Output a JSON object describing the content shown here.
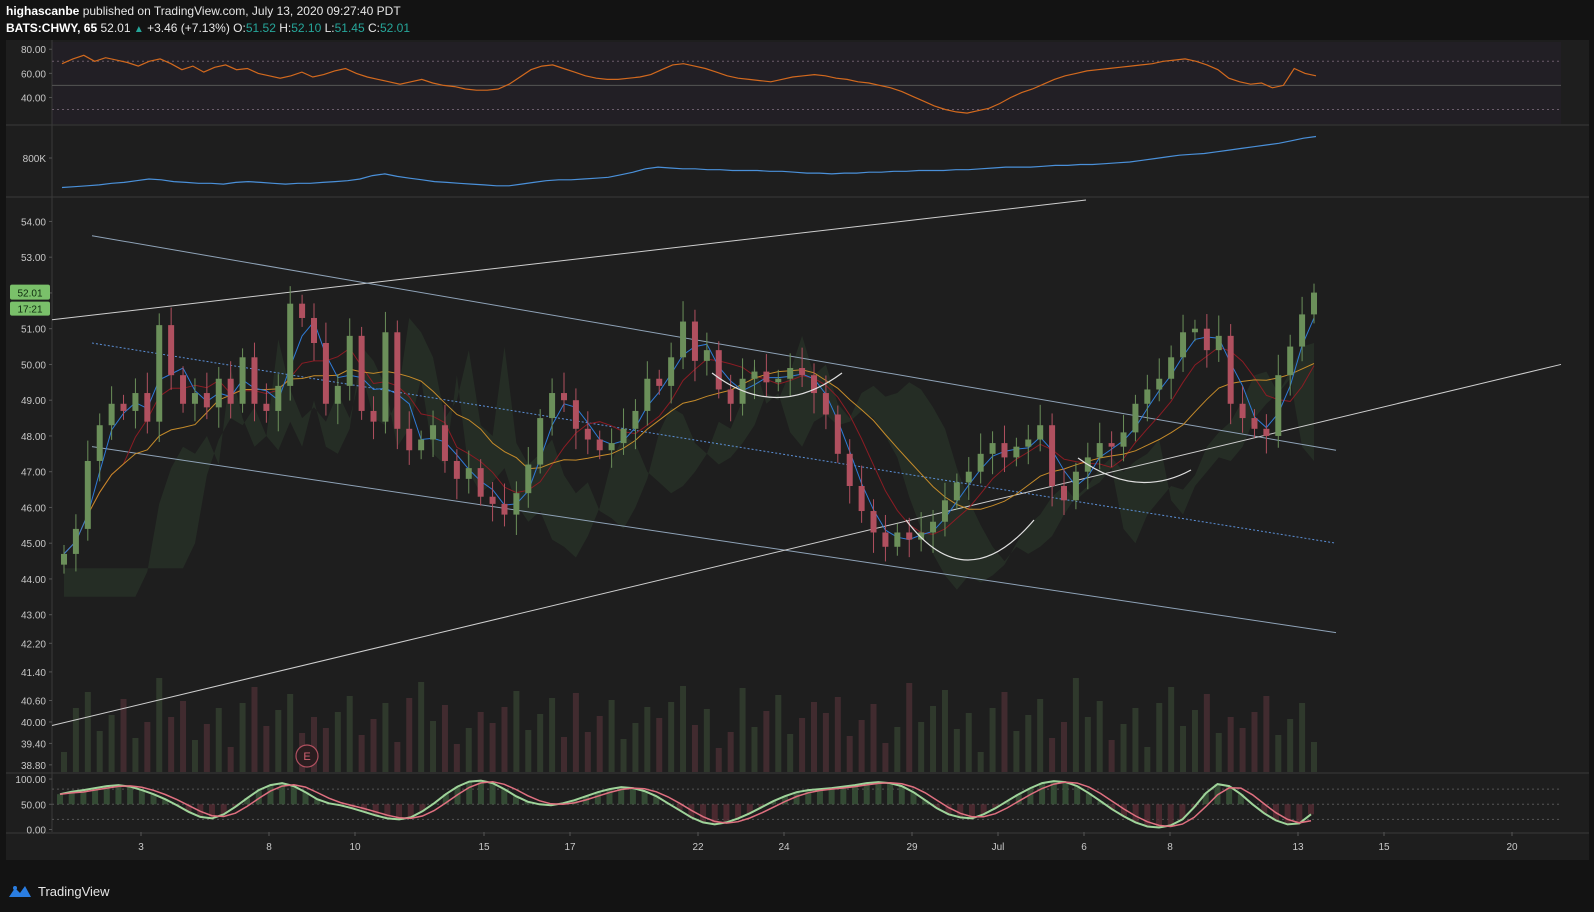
{
  "header": {
    "author": "highascanbe",
    "published_text": " published on TradingView.com, July 13, 2020 09:27:40 PDT",
    "symbol": "BATS:CHWY, 65",
    "last": "52.01",
    "change": "+3.46 (+7.13%)",
    "o_label": "O:",
    "o_value": "51.52",
    "h_label": "H:",
    "h_value": "52.10",
    "l_label": "L:",
    "l_value": "51.45",
    "c_label": "C:",
    "c_value": "52.01"
  },
  "footer": {
    "brand": "TradingView",
    "logo_icon": "tradingview-logo-icon"
  },
  "colors": {
    "background": "#1e1e1e",
    "up": "#6b8f5a",
    "down": "#b0505f",
    "rsi": "#d2691e",
    "volume_ma": "#4a90d9",
    "ema_fast": "#2f7bd6",
    "ema_slow": "#c58b2a",
    "kijun": "#8b1c24"
  },
  "chart_data": [
    {
      "type": "line",
      "panel": "rsi",
      "y_ticks": [
        "80.00",
        "60.00",
        "40.00"
      ],
      "ylim": [
        18,
        86
      ],
      "values": [
        68,
        72,
        75,
        70,
        73,
        71,
        69,
        66,
        70,
        72,
        68,
        63,
        66,
        61,
        65,
        67,
        63,
        64,
        60,
        58,
        56,
        58,
        61,
        57,
        59,
        62,
        64,
        60,
        57,
        55,
        53,
        51,
        53,
        55,
        52,
        50,
        49,
        47,
        46,
        46,
        47,
        51,
        57,
        63,
        66,
        67,
        64,
        61,
        58,
        56,
        55,
        55,
        56,
        57,
        59,
        63,
        67,
        68,
        66,
        64,
        61,
        58,
        56,
        55,
        54,
        53,
        55,
        57,
        58,
        59,
        58,
        56,
        55,
        53,
        52,
        50,
        48,
        45,
        41,
        37,
        33,
        30,
        28,
        27,
        29,
        31,
        35,
        40,
        44,
        47,
        51,
        55,
        58,
        60,
        62,
        63,
        64,
        65,
        66,
        67,
        68,
        70,
        71,
        72,
        70,
        67,
        63,
        56,
        53,
        51,
        52,
        48,
        50,
        64,
        60,
        58
      ],
      "bands": [
        70,
        50,
        30
      ]
    },
    {
      "type": "line",
      "panel": "volume_ma",
      "y_ticks": [
        "800K"
      ],
      "values": [
        40,
        41,
        42,
        43,
        45,
        46,
        48,
        50,
        49,
        47,
        46,
        45,
        45,
        44,
        46,
        47,
        46,
        45,
        44,
        45,
        45,
        46,
        47,
        48,
        50,
        54,
        56,
        53,
        51,
        49,
        47,
        46,
        45,
        44,
        43,
        42,
        42,
        44,
        46,
        48,
        49,
        49,
        50,
        51,
        52,
        55,
        58,
        62,
        64,
        63,
        62,
        62,
        61,
        61,
        60,
        60,
        60,
        59,
        59,
        58,
        57,
        57,
        56,
        57,
        57,
        58,
        58,
        59,
        59,
        60,
        60,
        60,
        61,
        61,
        62,
        63,
        64,
        64,
        64,
        65,
        66,
        66,
        67,
        67,
        68,
        69,
        70,
        72,
        74,
        76,
        78,
        79,
        80,
        82,
        84,
        86,
        88,
        90,
        92,
        95,
        98,
        100
      ],
      "ylim": [
        30,
        110
      ]
    },
    {
      "type": "candlestick",
      "panel": "price",
      "title": "",
      "y_ticks": [
        "54.00",
        "53.00",
        "52.00",
        "51.00",
        "50.00",
        "49.00",
        "48.00",
        "47.00",
        "46.00",
        "45.00",
        "44.00",
        "43.00",
        "42.20",
        "41.40",
        "40.60",
        "40.00",
        "39.40",
        "38.80"
      ],
      "price_tag_last": "52.01",
      "price_tag_timer": "17:21",
      "x_ticks": [
        "3",
        "8",
        "10",
        "15",
        "17",
        "22",
        "24",
        "29",
        "Jul",
        "6",
        "8",
        "13",
        "15",
        "20"
      ],
      "ylim": [
        38.6,
        54.6
      ],
      "closes": [
        44.7,
        45.4,
        47.3,
        48.3,
        48.9,
        48.7,
        49.2,
        48.4,
        51.1,
        49.7,
        48.9,
        49.2,
        48.8,
        49.6,
        48.9,
        50.2,
        48.9,
        48.7,
        49.4,
        51.7,
        51.3,
        50.6,
        48.9,
        49.4,
        50.8,
        48.7,
        48.4,
        50.9,
        48.2,
        47.6,
        47.9,
        48.3,
        47.3,
        46.8,
        47.1,
        46.3,
        46.1,
        45.8,
        46.4,
        47.2,
        48.5,
        49.2,
        49.0,
        48.2,
        47.9,
        47.6,
        47.8,
        48.2,
        48.7,
        49.6,
        49.4,
        50.2,
        51.2,
        50.1,
        50.4,
        49.3,
        48.9,
        49.6,
        49.8,
        49.5,
        49.6,
        49.9,
        49.7,
        49.2,
        48.6,
        47.5,
        46.6,
        45.9,
        45.3,
        44.9,
        45.3,
        45.1,
        45.3,
        45.6,
        46.2,
        46.7,
        47.0,
        47.5,
        47.8,
        47.4,
        47.7,
        47.9,
        48.3,
        46.6,
        46.2,
        47.0,
        47.4,
        47.8,
        47.7,
        48.1,
        48.9,
        49.3,
        49.6,
        50.2,
        50.9,
        51.0,
        50.4,
        50.8,
        48.9,
        48.5,
        48.2,
        48.0,
        49.7,
        50.5,
        51.4,
        52.01
      ],
      "annotations": [
        "E"
      ]
    },
    {
      "type": "line",
      "panel": "stochastic",
      "y_ticks": [
        "100.00",
        "50.00",
        "0.00"
      ],
      "ylim": [
        -5,
        110
      ],
      "values": [
        70,
        75,
        78,
        82,
        86,
        88,
        85,
        78,
        70,
        60,
        48,
        35,
        25,
        22,
        30,
        45,
        62,
        78,
        88,
        92,
        86,
        74,
        60,
        52,
        48,
        42,
        35,
        28,
        22,
        20,
        24,
        36,
        52,
        70,
        85,
        95,
        97,
        92,
        80,
        66,
        55,
        50,
        48,
        52,
        58,
        66,
        74,
        80,
        84,
        82,
        76,
        66,
        52,
        38,
        24,
        14,
        10,
        14,
        22,
        32,
        44,
        56,
        66,
        74,
        78,
        80,
        82,
        85,
        88,
        92,
        94,
        92,
        86,
        74,
        58,
        42,
        30,
        24,
        22,
        30,
        42,
        56,
        70,
        82,
        92,
        96,
        94,
        86,
        72,
        56,
        40,
        26,
        14,
        6,
        4,
        8,
        20,
        44,
        72,
        90,
        86,
        70,
        50,
        32,
        18,
        10,
        12,
        30
      ]
    }
  ]
}
